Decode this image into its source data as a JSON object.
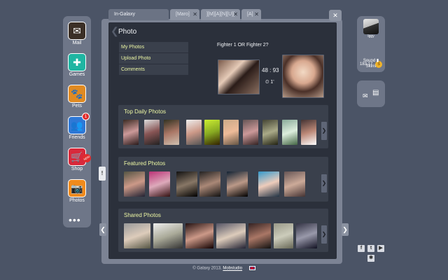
{
  "dock": {
    "apps": [
      {
        "label": "Mail",
        "icon": "mail-icon",
        "glyph": "✉",
        "color": "#3b2f26"
      },
      {
        "label": "Games",
        "icon": "gamepad-icon",
        "glyph": "✚",
        "color": "#1fb5a2"
      },
      {
        "label": "Pets",
        "icon": "pet-icon",
        "glyph": "🐾",
        "color": "#e08a22"
      },
      {
        "label": "Friends",
        "icon": "friends-icon",
        "glyph": "👥",
        "color": "#2e78d6",
        "badge": "1"
      },
      {
        "label": "Shop",
        "icon": "cart-icon",
        "glyph": "🛒",
        "color": "#d8293b",
        "badge_new": "NEW"
      },
      {
        "label": "Photos",
        "icon": "camera-icon",
        "glyph": "📷",
        "color": "#f08a1c"
      }
    ],
    "more": "•••"
  },
  "tabs": [
    {
      "label": "In-Galaxy",
      "active": true
    },
    {
      "label": "[Maro]",
      "close": "✕"
    },
    {
      "label": "][M][A][N][U][",
      "close": "✕"
    },
    {
      "label": "[A]",
      "close": "✕"
    }
  ],
  "window_close": "✕",
  "page": {
    "title": "Photo",
    "back": "❮",
    "menu": [
      "My Photos",
      "Upload Photo",
      "Comments"
    ]
  },
  "fight": {
    "title": "Fighter 1 OR Fighter 2?",
    "score": "48 : 93",
    "timer": "1'"
  },
  "sections": {
    "top_daily": "Top Daily Photos",
    "featured": "Featured Photos",
    "shared": "Shared Photos",
    "more_arrow": "❯"
  },
  "side": {
    "left_arrow": "❮",
    "right_arrow": "❯",
    "handle": "!"
  },
  "user": {
    "name": "Iggy",
    "coins": "183.17",
    "coin_symbol": "$",
    "sound": "Sound",
    "skins": "Skins"
  },
  "social": [
    "f",
    "t",
    "▶",
    "✱"
  ],
  "footer": {
    "copyright": "© Galaxy 2013,",
    "studio": "Mobstudio"
  }
}
